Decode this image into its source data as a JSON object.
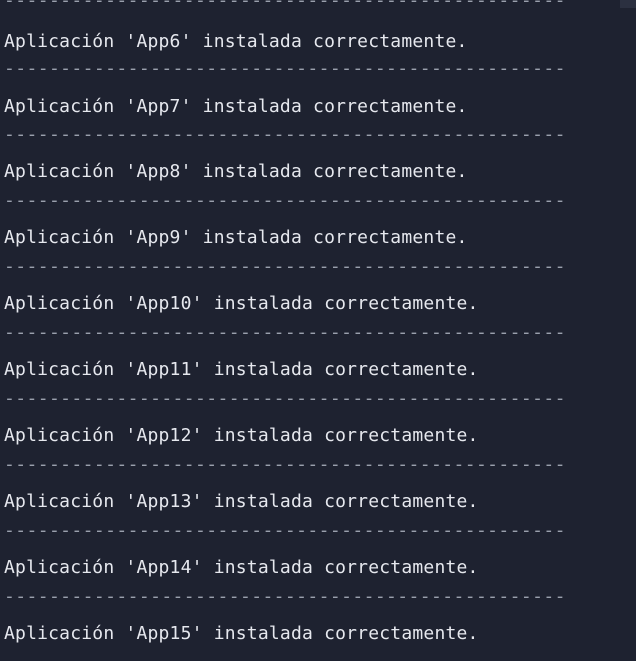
{
  "terminal": {
    "separator": "--------------------------------------------------",
    "lines": [
      {
        "text": "Aplicación 'App6' instalada correctamente."
      },
      {
        "text": "Aplicación 'App7' instalada correctamente."
      },
      {
        "text": "Aplicación 'App8' instalada correctamente."
      },
      {
        "text": "Aplicación 'App9' instalada correctamente."
      },
      {
        "text": "Aplicación 'App10' instalada correctamente."
      },
      {
        "text": "Aplicación 'App11' instalada correctamente."
      },
      {
        "text": "Aplicación 'App12' instalada correctamente."
      },
      {
        "text": "Aplicación 'App13' instalada correctamente."
      },
      {
        "text": "Aplicación 'App14' instalada correctamente."
      },
      {
        "text": "Aplicación 'App15' instalada correctamente."
      }
    ]
  },
  "colors": {
    "background": "#1e2230",
    "text": "#e6e8ee",
    "separator": "#9aa0ad"
  }
}
